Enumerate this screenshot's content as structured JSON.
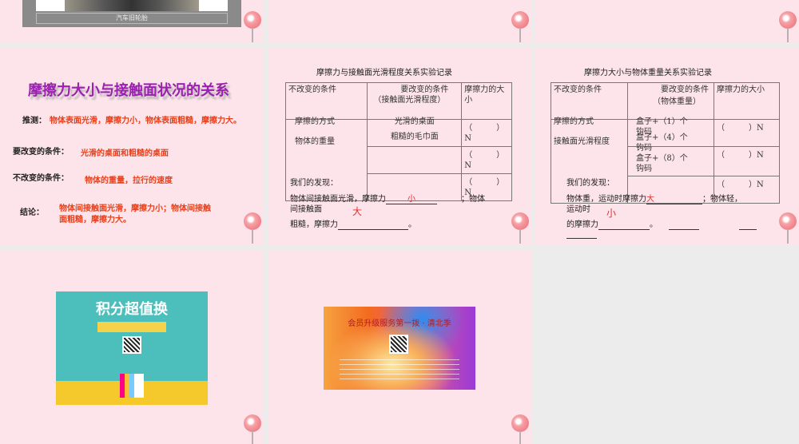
{
  "slides": [
    {
      "caption": "汽车旧轮胎"
    },
    {},
    {},
    {
      "title": "摩擦力大小与接触面状况的关系",
      "guess_label": "推测：",
      "guess": "物体表面光滑，摩擦力小，物体表面粗糙，摩擦力大。",
      "change_label": "要改变的条件：",
      "change": "光滑的桌面和粗糙的桌面",
      "keep_label": "不改变的条件：",
      "keep": "物体的重量，拉行的速度",
      "conclusion_label": "结论：",
      "conclusion_1": "物体间接触面光滑，摩擦力小；物体间接触",
      "conclusion_2": "面粗糙，摩擦力大。"
    },
    {
      "title": "摩擦力与接触面光滑程度关系实验记录",
      "headers": [
        "不改变的条件",
        "要改变的条件",
        "（接触面光滑程度）",
        "摩擦力的大小"
      ],
      "keep_items": [
        "摩擦的方式",
        "物体的重量"
      ],
      "change_items": [
        "光滑的桌面",
        "粗糙的毛巾面"
      ],
      "force_cell": "（　　　）N",
      "finding_label": "我们的发现：",
      "finding_1": "物体间接触面光滑，摩擦力",
      "answer_1": "小",
      "finding_1b": "；物体",
      "finding_2": "间接触面",
      "answer_2": "大",
      "finding_3": "粗糙，摩擦力",
      "finding_3b": "。"
    },
    {
      "title": "摩擦力大小与物体重量关系实验记录",
      "headers": [
        "不改变的条件",
        "要改变的条件",
        "（物体重量）",
        "摩擦力的大小"
      ],
      "keep_items": [
        "摩擦的方式",
        "接触面光滑程度"
      ],
      "change_items": [
        "盒子+（1）个钩码",
        "盒子+（4）个钩码",
        "盒子+（8）个钩码"
      ],
      "force_cell": "（　　　）N",
      "finding_label": "我们的发现：",
      "finding_1": "物体重，运动时摩擦力",
      "answer_1": "大",
      "finding_1b": "；物体轻，",
      "finding_2": "运动时",
      "answer_2": "小",
      "finding_3": "的摩擦力",
      "finding_3b": "。"
    },
    {
      "ad_title": "积分超值换"
    },
    {
      "ad_title": "会员升级服务第一拨 · 清北季"
    }
  ]
}
